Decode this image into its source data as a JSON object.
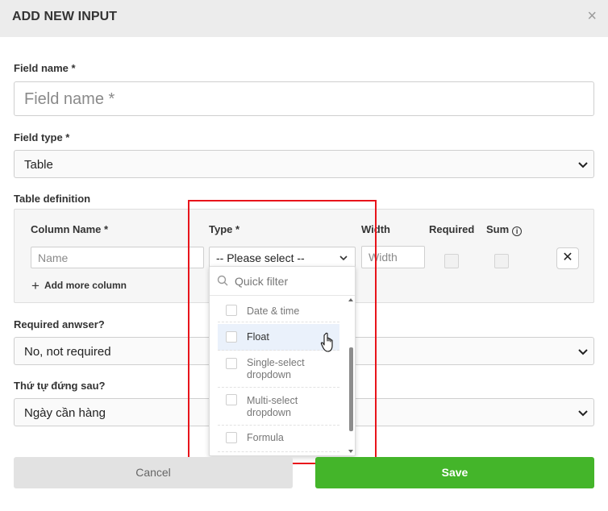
{
  "dialog": {
    "title": "ADD NEW INPUT",
    "close_symbol": "×"
  },
  "field_name": {
    "label": "Field name *",
    "placeholder": "Field name *"
  },
  "field_type": {
    "label": "Field type *",
    "value": "Table"
  },
  "table_definition": {
    "label": "Table definition",
    "headers": {
      "column_name": "Column Name *",
      "type": "Type *",
      "width": "Width",
      "required": "Required",
      "sum": "Sum"
    },
    "row": {
      "name_placeholder": "Name",
      "type_value": "-- Please select --",
      "width_placeholder": "Width",
      "remove_symbol": "✕"
    },
    "add_more_label": "Add more column"
  },
  "type_dropdown": {
    "filter_placeholder": "Quick filter",
    "options": [
      {
        "label": "Date & time"
      },
      {
        "label": "Float",
        "highlighted": true
      },
      {
        "label": "Single-select dropdown"
      },
      {
        "label": "Multi-select dropdown"
      },
      {
        "label": "Formula"
      }
    ]
  },
  "required_answer": {
    "label": "Required anwser?",
    "value": "No, not required"
  },
  "order_after": {
    "label": "Thứ tự đứng sau?",
    "value": "Ngày cần hàng"
  },
  "buttons": {
    "cancel": "Cancel",
    "save": "Save"
  },
  "colors": {
    "save_green": "#44b52a",
    "highlight_red": "#e8141b",
    "header_gray": "#ececec"
  }
}
